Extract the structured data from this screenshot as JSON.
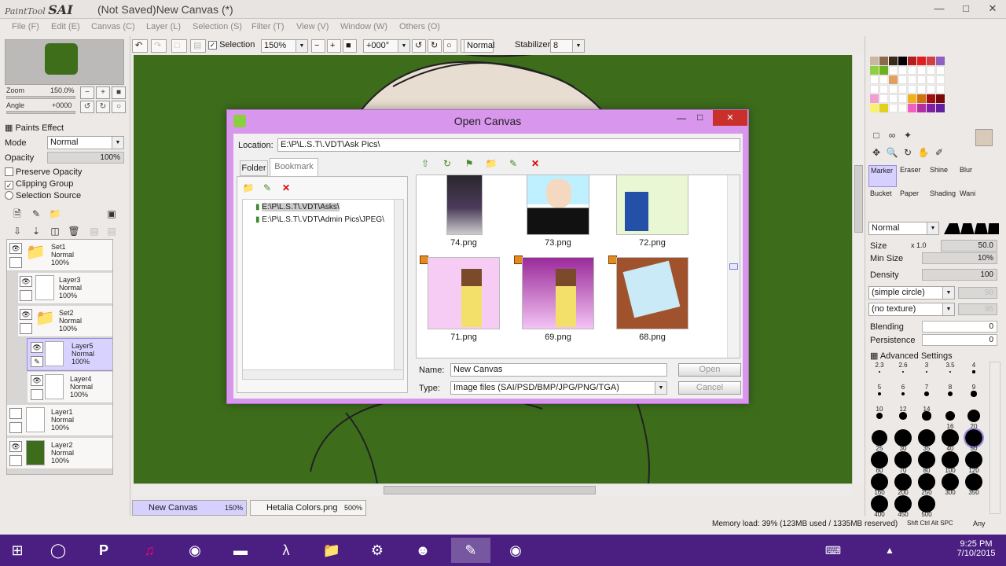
{
  "app": {
    "logo_small": "PaintTool",
    "logo_big": "SAI",
    "window_title": "(Not Saved)New Canvas (*)"
  },
  "menu": [
    "File (F)",
    "Edit (E)",
    "Canvas (C)",
    "Layer (L)",
    "Selection (S)",
    "Filter (T)",
    "View (V)",
    "Window (W)",
    "Others (O)"
  ],
  "toolbar": {
    "selection_label": "Selection",
    "zoom_value": "150%",
    "rotation_value": "+000°",
    "blend_mode": "Normal",
    "stabilizer_label": "Stabilizer",
    "stabilizer_value": "8"
  },
  "navigator": {
    "zoom_label": "Zoom",
    "zoom_value": "150.0%",
    "angle_label": "Angle",
    "angle_value": "+0000"
  },
  "layer_panel": {
    "paints_effect": "Paints Effect",
    "mode_label": "Mode",
    "mode_value": "Normal",
    "opacity_label": "Opacity",
    "opacity_value": "100%",
    "preserve_opacity": "Preserve Opacity",
    "clipping_group": "Clipping Group",
    "selection_source": "Selection Source",
    "layers": [
      {
        "name": "Set1",
        "mode": "Normal",
        "opacity": "100%"
      },
      {
        "name": "Layer3",
        "mode": "Normal",
        "opacity": "100%"
      },
      {
        "name": "Set2",
        "mode": "Normal",
        "opacity": "100%"
      },
      {
        "name": "Layer5",
        "mode": "Normal",
        "opacity": "100%"
      },
      {
        "name": "Layer4",
        "mode": "Normal",
        "opacity": "100%"
      },
      {
        "name": "Layer1",
        "mode": "Normal",
        "opacity": "100%"
      },
      {
        "name": "Layer2",
        "mode": "Normal",
        "opacity": "100%"
      }
    ]
  },
  "tabs": [
    {
      "name": "New Canvas",
      "zoom": "150%"
    },
    {
      "name": "Hetalia Colors.png",
      "zoom": "500%"
    }
  ],
  "status": {
    "memory": "Memory load: 39% (123MB used / 1335MB reserved)",
    "keys": "Shft Ctrl Alt SPC",
    "any": "Any"
  },
  "tools": {
    "row1": [
      "Marker",
      "Eraser",
      "Shine",
      "Blur"
    ],
    "row2": [
      "Bucket",
      "Paper",
      "Shading",
      "Wani"
    ]
  },
  "brush": {
    "mode": "Normal",
    "size_label": "Size",
    "size_mult": "x 1.0",
    "size_value": "50.0",
    "min_size_label": "Min Size",
    "min_size_value": "10%",
    "density_label": "Density",
    "density_value": "100",
    "shape": "(simple circle)",
    "shape_value": "50",
    "texture": "(no texture)",
    "texture_value": "95",
    "blending_label": "Blending",
    "blending_value": "0",
    "persistence_label": "Persistence",
    "persistence_value": "0",
    "advanced": "Advanced Settings",
    "size_presets": [
      "2.3",
      "2.6",
      "3",
      "3.5",
      "4",
      "5",
      "6",
      "7",
      "8",
      "9",
      "10",
      "12",
      "14",
      "16",
      "20",
      "25",
      "30",
      "35",
      "40",
      "50",
      "60",
      "70",
      "80",
      "100",
      "120",
      "160",
      "200",
      "250",
      "300",
      "350",
      "400",
      "450",
      "500"
    ]
  },
  "dialog": {
    "title": "Open Canvas",
    "location_label": "Location:",
    "location_value": "E:\\P\\L.S.T\\.VDT\\Ask Pics\\",
    "tab_folder": "Folder",
    "tab_bookmark": "Bookmark",
    "bookmarks": [
      "E:\\P\\L.S.T\\.VDT\\Asks\\",
      "E:\\P\\L.S.T\\.VDT\\Admin Pics\\JPEG\\"
    ],
    "files_row1": [
      "74.png",
      "73.png",
      "72.png"
    ],
    "files_row2": [
      "71.png",
      "69.png",
      "68.png"
    ],
    "name_label": "Name:",
    "name_value": "New Canvas",
    "type_label": "Type:",
    "type_value": "Image files (SAI/PSD/BMP/JPG/PNG/TGA)",
    "open_button": "Open",
    "cancel_button": "Cancel"
  },
  "taskbar": {
    "time": "9:25 PM",
    "date": "7/10/2015"
  },
  "colors": {
    "canvas_bg": "#3d6d1b",
    "dialog_frame": "#d896ec",
    "taskbar": "#4b1f82",
    "selection": "#d6d0ff"
  }
}
